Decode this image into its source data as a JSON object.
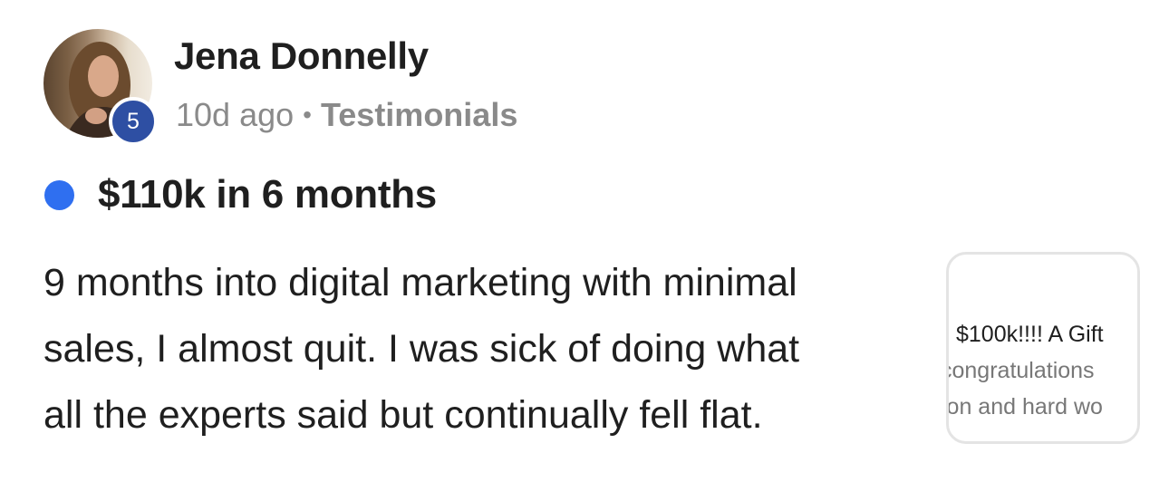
{
  "author": {
    "name": "Jena Donnelly",
    "level": "5"
  },
  "meta": {
    "time": "10d ago",
    "separator": "•",
    "category": "Testimonials"
  },
  "post": {
    "title": "$110k in 6 months",
    "body_lines": [
      "9 months into digital marketing with minimal",
      "sales, I almost quit. I was sick of doing what",
      "all the experts said but continually fell flat."
    ]
  },
  "attachment": {
    "preview_lines": [
      "$100k!!!! A Gift",
      "congratulations",
      "ion and hard wo"
    ]
  },
  "colors": {
    "unread_dot": "#2f6ff0",
    "level_badge": "#2e4fa3",
    "meta_text": "#8a8a8a"
  }
}
